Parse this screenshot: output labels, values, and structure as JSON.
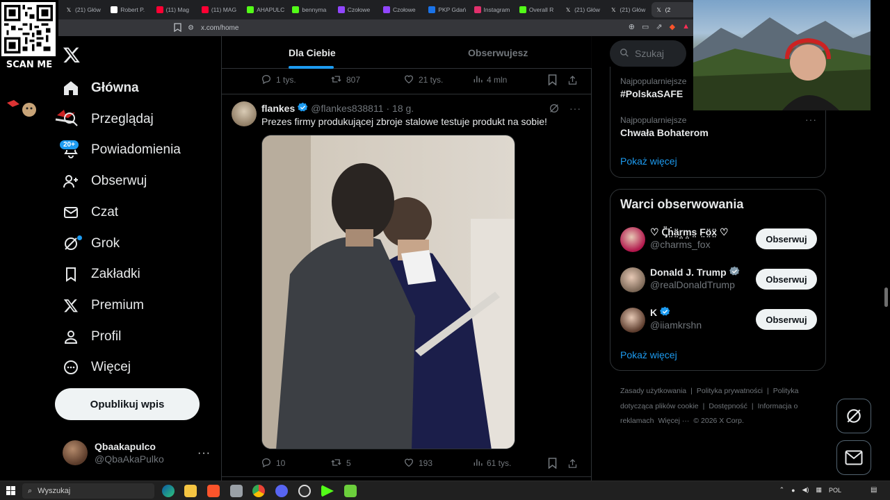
{
  "browser": {
    "tabs": [
      {
        "label": "(21) Głów",
        "icon": "x",
        "color": "#e7e9ea"
      },
      {
        "label": "Robert P.",
        "icon": "tiktok",
        "color": "#ffffff"
      },
      {
        "label": "(11) Mag",
        "icon": "youtube",
        "color": "#ff0033"
      },
      {
        "label": "(11) MAG",
        "icon": "youtube",
        "color": "#ff0033"
      },
      {
        "label": "AHAPULC",
        "icon": "kick",
        "color": "#53fc18"
      },
      {
        "label": "bennyma",
        "icon": "kick",
        "color": "#53fc18"
      },
      {
        "label": "Czołowe",
        "icon": "twitch",
        "color": "#9146ff"
      },
      {
        "label": "Czołowe",
        "icon": "twitch",
        "color": "#9146ff"
      },
      {
        "label": "PKP Gdań",
        "icon": "pkp",
        "color": "#1a73e8"
      },
      {
        "label": "Instagram",
        "icon": "instagram",
        "color": "#e1306c"
      },
      {
        "label": "Overall R",
        "icon": "kick",
        "color": "#53fc18"
      },
      {
        "label": "(21) Głów",
        "icon": "x",
        "color": "#e7e9ea"
      },
      {
        "label": "(21) Głów",
        "icon": "x",
        "color": "#e7e9ea"
      },
      {
        "label": "(2",
        "icon": "x",
        "color": "#e7e9ea"
      }
    ],
    "url": "x.com/home"
  },
  "overlay": {
    "scan_label": "SCAN ME"
  },
  "nav": {
    "items": [
      {
        "label": "Główna",
        "icon": "home-icon"
      },
      {
        "label": "Przeglądaj",
        "icon": "search-icon"
      },
      {
        "label": "Powiadomienia",
        "icon": "bell-icon"
      },
      {
        "label": "Obserwuj",
        "icon": "follow-icon"
      },
      {
        "label": "Czat",
        "icon": "mail-icon"
      },
      {
        "label": "Grok",
        "icon": "grok-icon"
      },
      {
        "label": "Zakładki",
        "icon": "bookmark-icon"
      },
      {
        "label": "Premium",
        "icon": "x-icon"
      },
      {
        "label": "Profil",
        "icon": "person-icon"
      },
      {
        "label": "Więcej",
        "icon": "more-circle-icon"
      }
    ],
    "notif_badge": "20+",
    "post_button": "Opublikuj wpis",
    "me": {
      "name": "Qbaakapulco",
      "handle": "@QbaAkaPulko"
    }
  },
  "feed": {
    "tabs": [
      "Dla Ciebie",
      "Obserwujesz"
    ],
    "prev_actions": {
      "replies": "1 tys.",
      "reposts": "807",
      "likes": "21 tys.",
      "views": "4 mln"
    },
    "tweet": {
      "name": "flankes",
      "handle": "@flankes838811",
      "time": "· 18 g.",
      "text": "Prezes firmy produkującej zbroje stalowe testuje produkt na sobie!",
      "replies": "10",
      "reposts": "5",
      "likes": "193",
      "views": "61 tys."
    }
  },
  "right": {
    "search_placeholder": "Szukaj",
    "trends": [
      {
        "category": "Najpopularniejsze",
        "name": "#PolskaSAFE"
      },
      {
        "category": "Najpopularniejsze",
        "name": "Chwała Bohaterom"
      }
    ],
    "show_more": "Pokaż więcej",
    "who_to_follow": {
      "title": "Warci obserwowania",
      "users": [
        {
          "name": "♡ Ꞔ̈ḣ̤ä̤ṛ̤ṃ̤s̤ F̤ö̤ẍ̤ ♡",
          "handle": "@charms_fox",
          "verified": false,
          "color": "#b0144a"
        },
        {
          "name": "Donald J. Trump",
          "handle": "@realDonaldTrump",
          "verified": true,
          "color": "#7a6655"
        },
        {
          "name": "K",
          "handle": "@iiamkrshn",
          "verified": true,
          "color": "#5b3b2c"
        }
      ],
      "follow_label": "Obserwuj",
      "show_more": "Pokaż więcej"
    },
    "footer": [
      "Zasady użytkowania",
      "|",
      "Polityka prywatności",
      "|",
      "Polityka dotycząca plików cookie",
      "|",
      "Dostępność",
      "|",
      "Informacja o reklamach",
      "Więcej ···",
      "© 2026 X Corp."
    ]
  },
  "taskbar": {
    "search_label": "Wyszukaj",
    "lang": "POL"
  },
  "colors": {
    "accent": "#1d9bf0",
    "bg": "#000000",
    "border": "#2f3336"
  }
}
